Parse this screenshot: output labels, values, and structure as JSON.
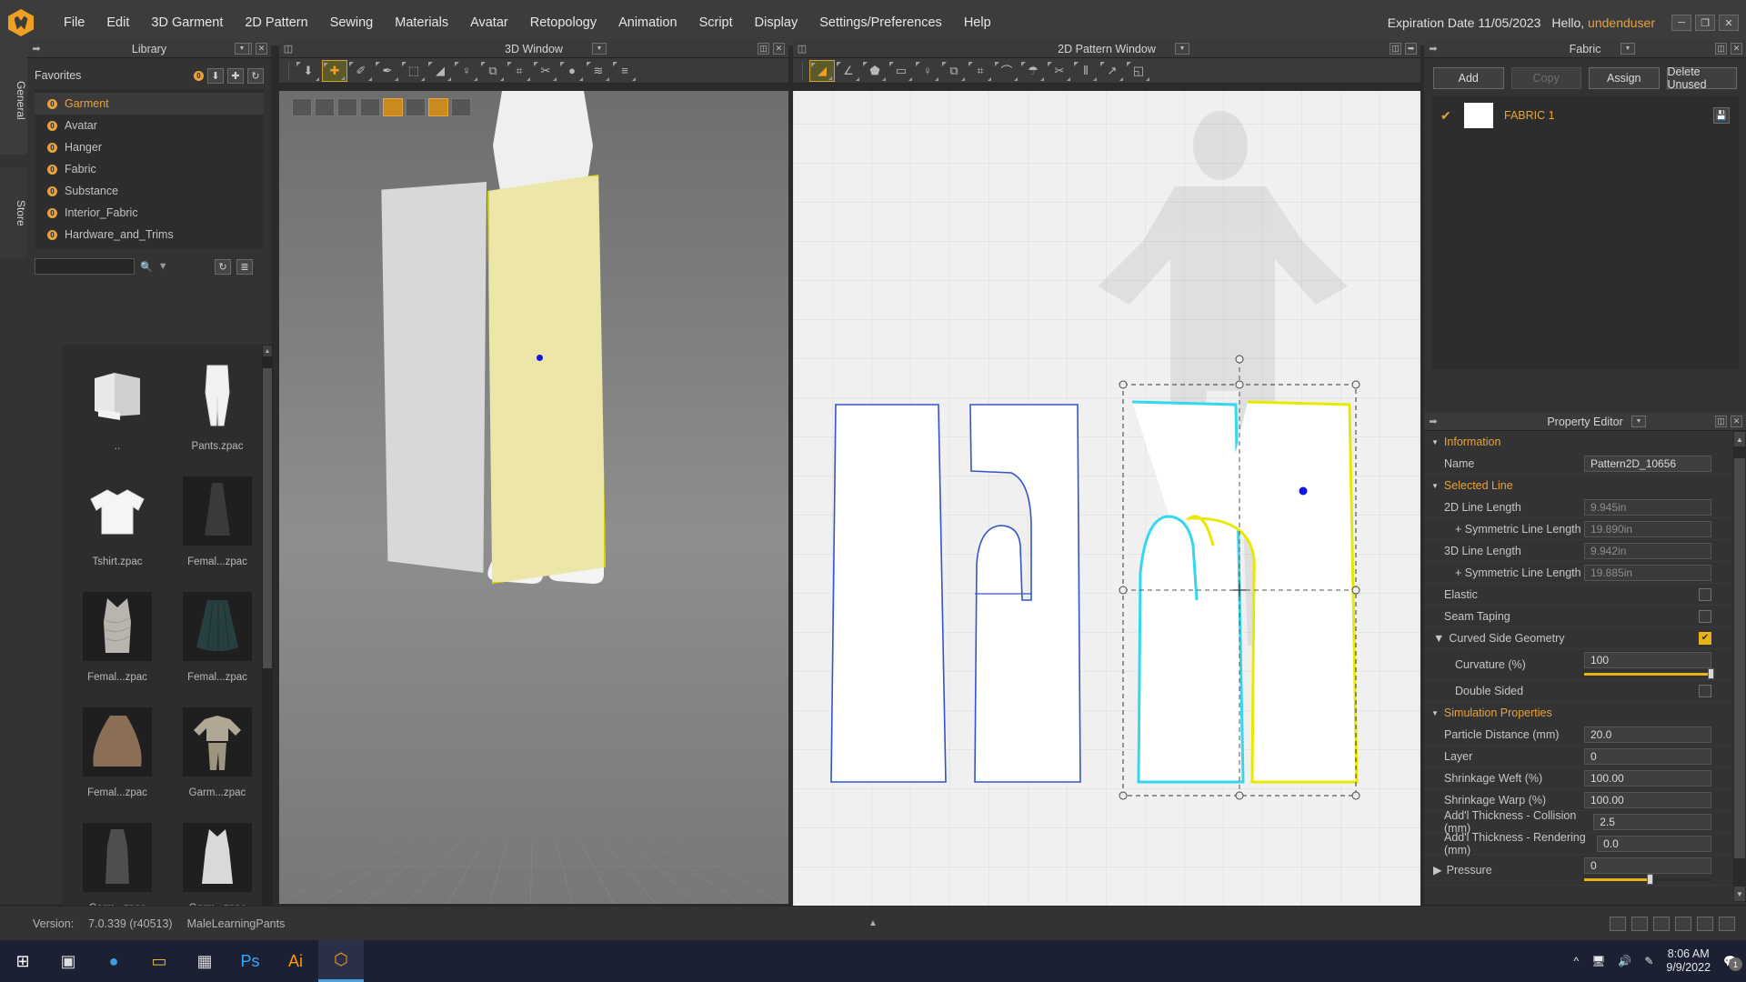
{
  "app": {
    "logo_icon": "clo-hex-logo-icon",
    "menu": [
      "File",
      "Edit",
      "3D Garment",
      "2D Pattern",
      "Sewing",
      "Materials",
      "Avatar",
      "Retopology",
      "Animation",
      "Script",
      "Display",
      "Settings/Preferences",
      "Help"
    ],
    "expiration": "Expiration Date 11/05/2023",
    "hello_prefix": "Hello, ",
    "user": "undenduser",
    "window_buttons": [
      "minimize",
      "restore",
      "close"
    ]
  },
  "left_rail": {
    "tabs": [
      "General",
      "Store"
    ]
  },
  "library": {
    "title": "Library",
    "favorites_label": "Favorites",
    "favorites": [
      {
        "label": "Garment",
        "selected": true
      },
      {
        "label": "Avatar",
        "selected": false
      },
      {
        "label": "Hanger",
        "selected": false
      },
      {
        "label": "Fabric",
        "selected": false
      },
      {
        "label": "Substance",
        "selected": false
      },
      {
        "label": "Interior_Fabric",
        "selected": false
      },
      {
        "label": "Hardware_and_Trims",
        "selected": false
      }
    ],
    "search_placeholder": "",
    "search_value": "",
    "items": [
      {
        "label": "..",
        "kind": "folder-up"
      },
      {
        "label": "Pants.zpac",
        "kind": "pants"
      },
      {
        "label": "Tshirt.zpac",
        "kind": "tshirt"
      },
      {
        "label": "Femal...zpac",
        "kind": "dress-dark"
      },
      {
        "label": "Femal...zpac",
        "kind": "dress-ruched"
      },
      {
        "label": "Femal...zpac",
        "kind": "skirt-teal"
      },
      {
        "label": "Femal...zpac",
        "kind": "skirt-brown"
      },
      {
        "label": "Garm...zpac",
        "kind": "outfit-set"
      },
      {
        "label": "Garm...zpac",
        "kind": "dress-gray"
      },
      {
        "label": "Garm...zpac",
        "kind": "dress-white"
      }
    ]
  },
  "window3d": {
    "title": "3D Window",
    "tools": [
      {
        "name": "select-mesh-tool",
        "glyph": "⬇",
        "active": false
      },
      {
        "name": "transform-tool",
        "glyph": "✚",
        "active": true
      },
      {
        "name": "pin-tool",
        "glyph": "✐",
        "active": false
      },
      {
        "name": "tack-tool",
        "glyph": "✒",
        "active": false
      },
      {
        "name": "fold-arrange-tool",
        "glyph": "⬚",
        "active": false
      },
      {
        "name": "flatten-tool",
        "glyph": "◢",
        "active": false
      },
      {
        "name": "avatar-measure-tool",
        "glyph": "♀",
        "active": false
      },
      {
        "name": "box-tool",
        "glyph": "⧉",
        "active": false
      },
      {
        "name": "grid-tool",
        "glyph": "⌗",
        "active": false
      },
      {
        "name": "zipper-tool",
        "glyph": "✂",
        "active": false
      },
      {
        "name": "button-tool",
        "glyph": "●",
        "active": false
      },
      {
        "name": "puckering-tool",
        "glyph": "≋",
        "active": false
      },
      {
        "name": "topstitch-tool",
        "glyph": "≡",
        "active": false
      }
    ],
    "overlay_toggles": [
      {
        "name": "garment-display-icon",
        "on": false
      },
      {
        "name": "texture-display-icon",
        "on": false
      },
      {
        "name": "sewing-display-icon",
        "on": false
      },
      {
        "name": "avatar-display-icon",
        "on": false
      },
      {
        "name": "pin-display-icon",
        "on": true
      },
      {
        "name": "shade-display-icon",
        "on": false
      },
      {
        "name": "light-display-icon",
        "on": true
      },
      {
        "name": "render-display-icon",
        "on": false
      }
    ]
  },
  "window2d": {
    "title": "2D Pattern Window",
    "tools": [
      {
        "name": "edit-pattern-tool",
        "glyph": "◢",
        "active": true
      },
      {
        "name": "edit-curve-point-tool",
        "glyph": "∠",
        "active": false
      },
      {
        "name": "polygon-tool",
        "glyph": "⬟",
        "active": false
      },
      {
        "name": "rectangle-tool",
        "glyph": "▭",
        "active": false
      },
      {
        "name": "avatar-tool",
        "glyph": "♀",
        "active": false
      },
      {
        "name": "box-tool",
        "glyph": "⧉",
        "active": false
      },
      {
        "name": "grid-tool",
        "glyph": "⌗",
        "active": false
      },
      {
        "name": "fold-tool",
        "glyph": "⌒",
        "active": false
      },
      {
        "name": "garment-tool",
        "glyph": "☂",
        "active": false
      },
      {
        "name": "trim-tool",
        "glyph": "✂",
        "active": false
      },
      {
        "name": "pleat-tool",
        "glyph": "⦀",
        "active": false
      },
      {
        "name": "measure-tool",
        "glyph": "↗",
        "active": false
      },
      {
        "name": "graphics-tool",
        "glyph": "◱",
        "active": false
      }
    ]
  },
  "fabric_panel": {
    "title": "Fabric",
    "buttons": [
      {
        "label": "Add",
        "enabled": true
      },
      {
        "label": "Copy",
        "enabled": false
      },
      {
        "label": "Assign",
        "enabled": true
      },
      {
        "label": "Delete Unused",
        "enabled": true
      }
    ],
    "rows": [
      {
        "name": "FABRIC 1",
        "checked": true,
        "swatch": "#ffffff",
        "save_icon": "save-icon"
      }
    ]
  },
  "property_editor": {
    "title": "Property Editor",
    "groups": [
      {
        "name": "Information",
        "expanded": true,
        "rows": [
          {
            "label": "Name",
            "value": "Pattern2D_10656",
            "type": "text",
            "readonly": false
          }
        ]
      },
      {
        "name": "Selected Line",
        "expanded": true,
        "rows": [
          {
            "label": "2D Line Length",
            "value": "9.945in",
            "type": "text",
            "readonly": true
          },
          {
            "label": "+ Symmetric Line Length",
            "value": "19.890in",
            "type": "text",
            "readonly": true,
            "indent": true
          },
          {
            "label": "3D Line Length",
            "value": "9.942in",
            "type": "text",
            "readonly": true
          },
          {
            "label": "+ Symmetric Line Length",
            "value": "19.885in",
            "type": "text",
            "readonly": true,
            "indent": true
          },
          {
            "label": "Elastic",
            "type": "checkbox",
            "checked": false
          },
          {
            "label": "Seam Taping",
            "type": "checkbox",
            "checked": false
          },
          {
            "label": "Curved Side Geometry",
            "type": "checkbox",
            "checked": true,
            "group_toggle": true
          },
          {
            "label": "Curvature (%)",
            "value": "100",
            "type": "slider",
            "slider_pct": 100,
            "indent": true
          },
          {
            "label": "Double Sided",
            "type": "checkbox",
            "checked": false,
            "indent": true
          }
        ]
      },
      {
        "name": "Simulation Properties",
        "expanded": true,
        "rows": [
          {
            "label": "Particle Distance (mm)",
            "value": "20.0",
            "type": "text"
          },
          {
            "label": "Layer",
            "value": "0",
            "type": "text"
          },
          {
            "label": "Shrinkage Weft (%)",
            "value": "100.00",
            "type": "text"
          },
          {
            "label": "Shrinkage Warp (%)",
            "value": "100.00",
            "type": "text"
          },
          {
            "label": "Add'l Thickness - Collision (mm)",
            "value": "2.5",
            "type": "text"
          },
          {
            "label": "Add'l Thickness - Rendering (mm)",
            "value": "0.0",
            "type": "text"
          },
          {
            "label": "Pressure",
            "value": "0",
            "type": "slider",
            "slider_pct": 52,
            "collapsed_group": true
          }
        ]
      }
    ]
  },
  "statusbar": {
    "version_label": "Version:",
    "version_value": "7.0.339 (r40513)",
    "project": "MaleLearningPants",
    "collapse_icon": "collapse-up-icon",
    "view_icons": [
      "layout-1-icon",
      "layout-2-icon",
      "layout-3-icon",
      "layout-4-icon",
      "layout-5-icon",
      "layout-6-icon"
    ]
  },
  "taskbar": {
    "items": [
      {
        "name": "start-button",
        "glyph": "⊞"
      },
      {
        "name": "task-view-button",
        "glyph": "▣"
      },
      {
        "name": "edge-browser",
        "glyph": "●"
      },
      {
        "name": "file-explorer",
        "glyph": "▭"
      },
      {
        "name": "microsoft-store",
        "glyph": "▦"
      },
      {
        "name": "photoshop",
        "glyph": "Ps"
      },
      {
        "name": "illustrator",
        "glyph": "Ai"
      },
      {
        "name": "clo3d",
        "glyph": "⬡"
      }
    ],
    "tray": {
      "show_hidden_icon": "chevron-up-icon",
      "network_icon": "network-icon",
      "volume_icon": "volume-icon",
      "pen_icon": "pen-icon",
      "time": "8:06 AM",
      "date": "9/9/2022",
      "notification_icon": "notification-icon",
      "notification_count": "1"
    }
  },
  "colors": {
    "accent": "#e8a33d",
    "panel_bg": "#333333",
    "window_bg": "#2b2b2b",
    "selected_yellow": "#e8e800",
    "selected_cyan": "#35d6ef",
    "pattern_blue": "#3355cc"
  }
}
